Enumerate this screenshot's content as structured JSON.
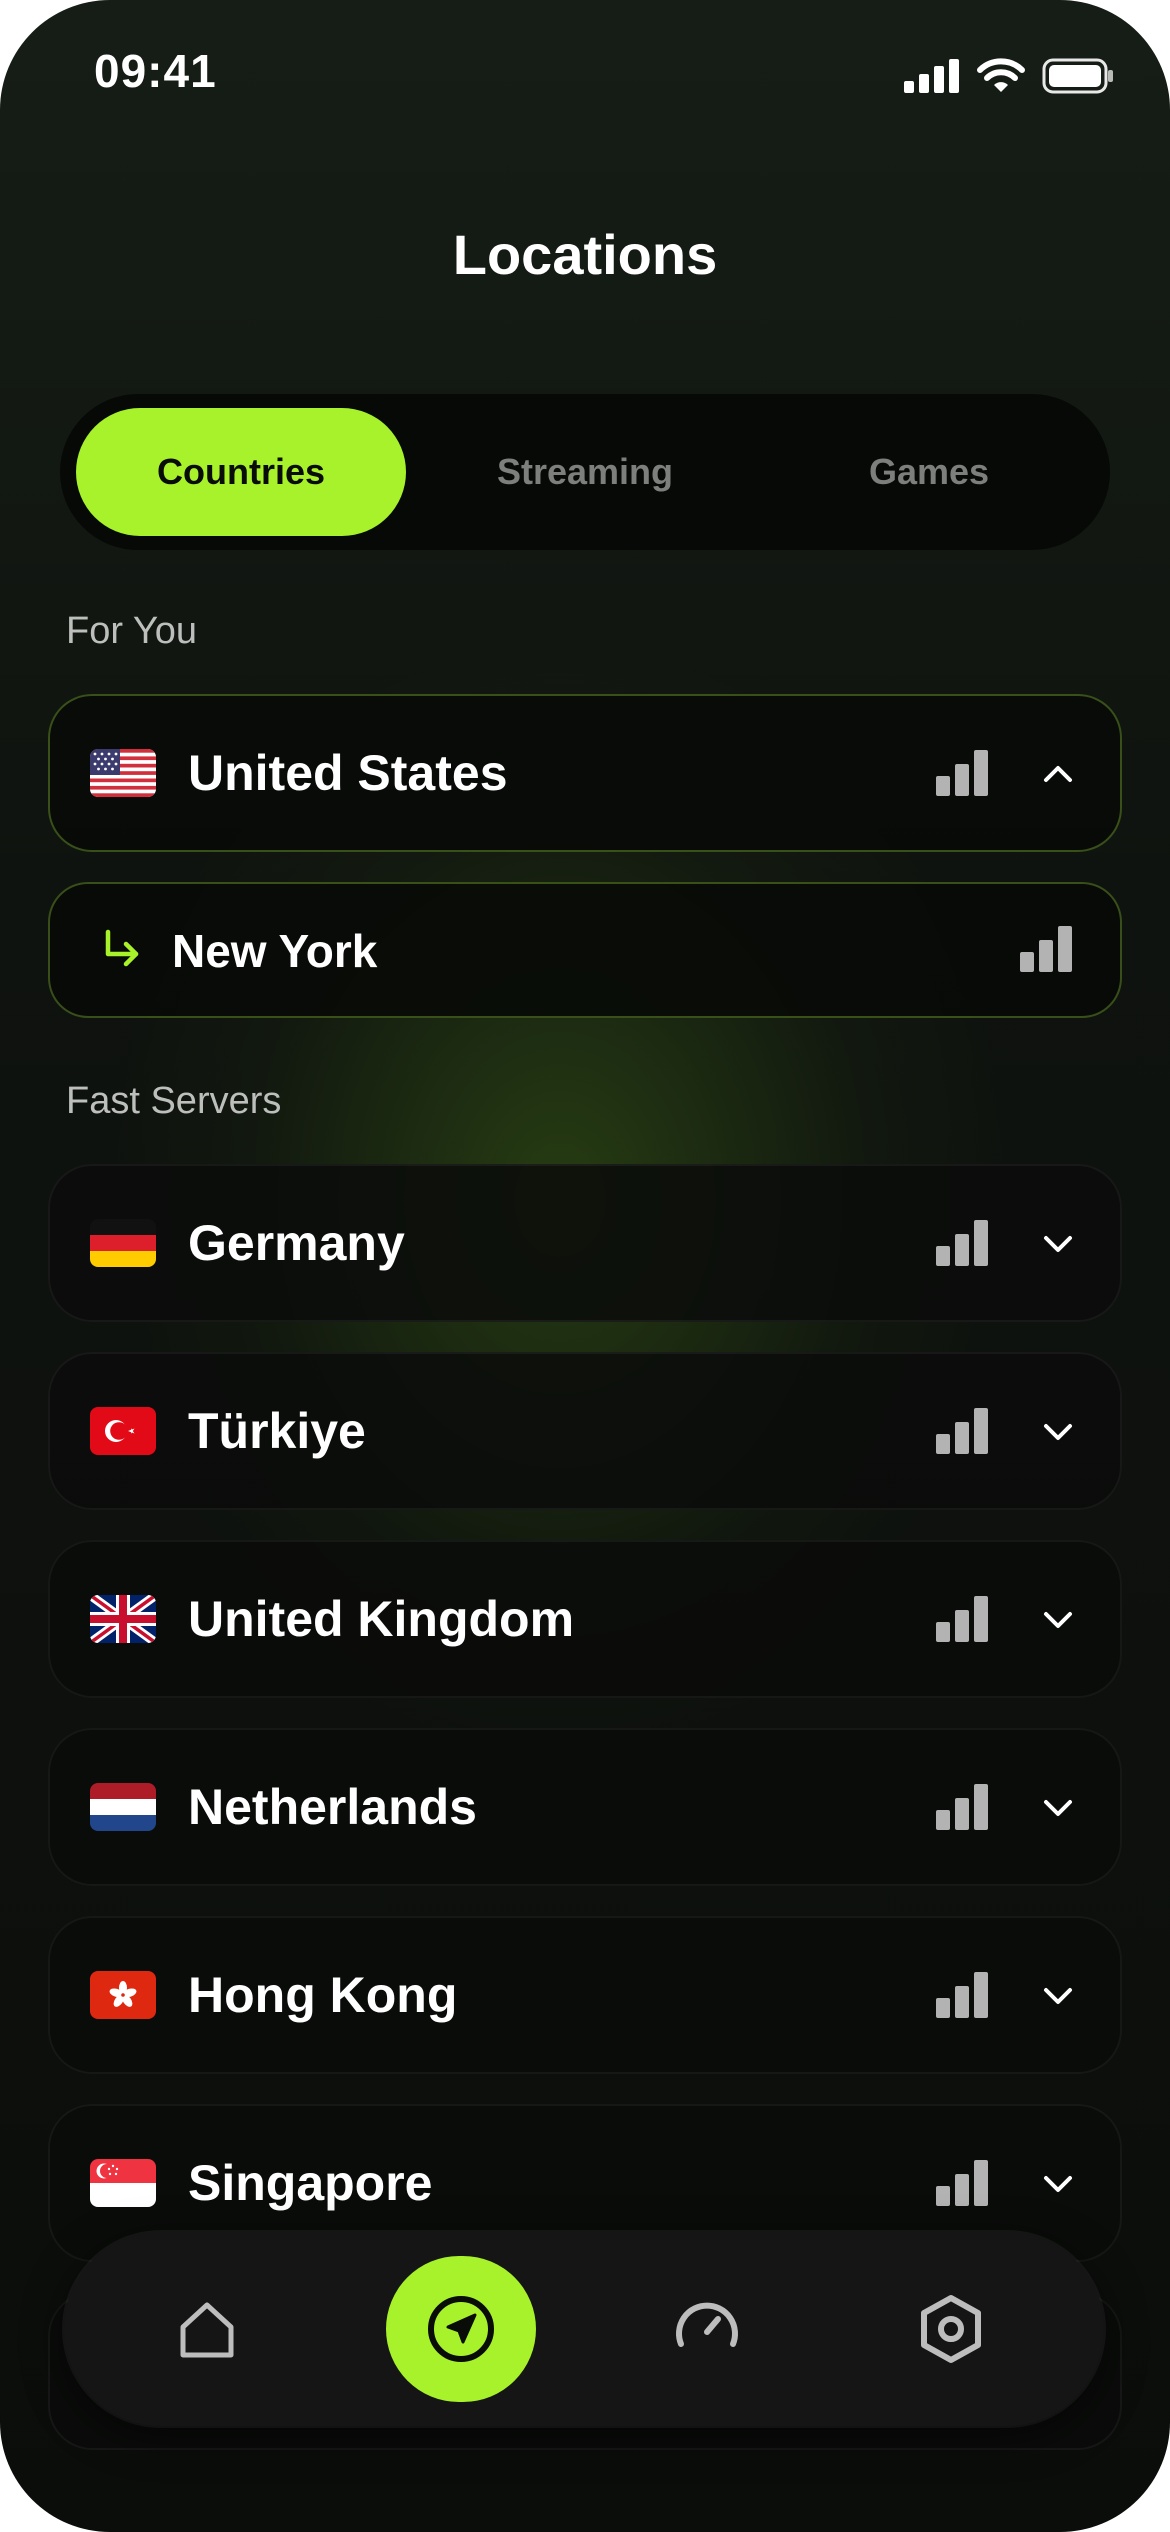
{
  "status_bar": {
    "time": "09:41"
  },
  "header": {
    "title": "Locations"
  },
  "tabs": [
    {
      "label": "Countries",
      "active": true
    },
    {
      "label": "Streaming",
      "active": false
    },
    {
      "label": "Games",
      "active": false
    }
  ],
  "sections": {
    "for_you": "For You",
    "fast_servers": "Fast Servers"
  },
  "for_you": {
    "country": "United States",
    "flag": "us-flag-icon",
    "expanded": true,
    "city": "New York"
  },
  "fast_servers": [
    {
      "name": "Germany",
      "flag": "de-flag-icon"
    },
    {
      "name": "Türkiye",
      "flag": "tr-flag-icon"
    },
    {
      "name": "United Kingdom",
      "flag": "gb-flag-icon"
    },
    {
      "name": "Netherlands",
      "flag": "nl-flag-icon"
    },
    {
      "name": "Hong Kong",
      "flag": "hk-flag-icon"
    },
    {
      "name": "Singapore",
      "flag": "sg-flag-icon"
    }
  ],
  "nav": [
    {
      "icon": "home-icon",
      "active": false
    },
    {
      "icon": "location-arrow-icon",
      "active": true
    },
    {
      "icon": "speedometer-icon",
      "active": false
    },
    {
      "icon": "settings-hexagon-icon",
      "active": false
    }
  ],
  "colors": {
    "accent": "#a7f22a",
    "background": "#0f130f",
    "card": "#0a0c0a",
    "muted_text": "#7d7f7d"
  }
}
